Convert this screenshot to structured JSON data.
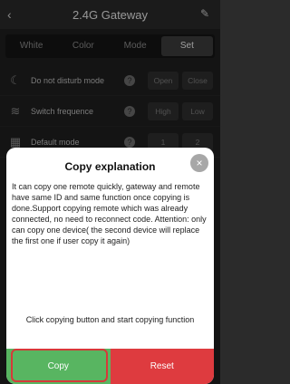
{
  "header": {
    "title": "2.4G Gateway"
  },
  "tabs": [
    {
      "label": "White",
      "active": false
    },
    {
      "label": "Color",
      "active": false
    },
    {
      "label": "Mode",
      "active": false
    },
    {
      "label": "Set",
      "active": true
    }
  ],
  "settings": [
    {
      "label": "Do not disturb mode",
      "icon": "moon-icon",
      "options": [
        "Open",
        "Close"
      ]
    },
    {
      "label": "Switch frequence",
      "icon": "wave-icon",
      "options": [
        "High",
        "Low"
      ]
    },
    {
      "label": "Default mode",
      "icon": "grid-icon",
      "options": [
        "1",
        "2"
      ]
    }
  ],
  "modal": {
    "title": "Copy explanation",
    "body": "It can copy one remote quickly, gateway and remote have same ID and same function once copying is done.Support copying remote which was already connected, no need to reconnect code. Attention: only can copy one device( the second device will replace the first one if user copy it again)",
    "hint": "Click copying button and start copying function",
    "buttons": {
      "copy": "Copy",
      "reset": "Reset"
    }
  },
  "colors": {
    "copy": "#58b561",
    "reset": "#de3b3f"
  }
}
